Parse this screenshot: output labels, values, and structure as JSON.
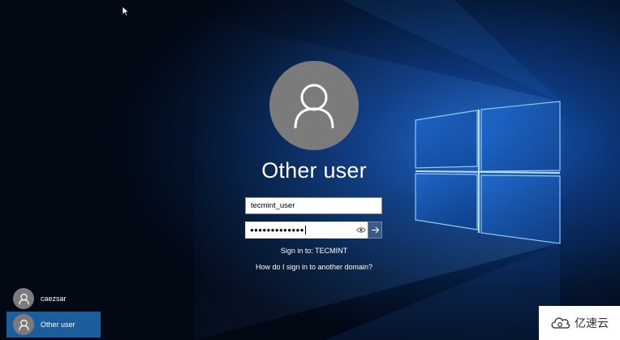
{
  "login": {
    "display_name": "Other user",
    "username_value": "tecmint_user",
    "password_masked": "●●●●●●●●●●●●●",
    "sign_in_to": "Sign in to: TECMINT",
    "help_link": "How do I sign in to another domain?"
  },
  "users": [
    {
      "name": "caezsar",
      "selected": false
    },
    {
      "name": "Other user",
      "selected": true
    }
  ],
  "watermark": {
    "text": "亿速云",
    "logo": "cloud-logo-icon"
  },
  "icons": {
    "avatar": "user-silhouette-icon",
    "reveal": "eye-icon",
    "submit": "arrow-right-icon",
    "cursor": "mouse-pointer-icon"
  },
  "colors": {
    "background": "#020b1c",
    "accent": "#1c5d9e",
    "avatar_gray": "#7b7b7b",
    "submit_button": "#3b5a86"
  }
}
